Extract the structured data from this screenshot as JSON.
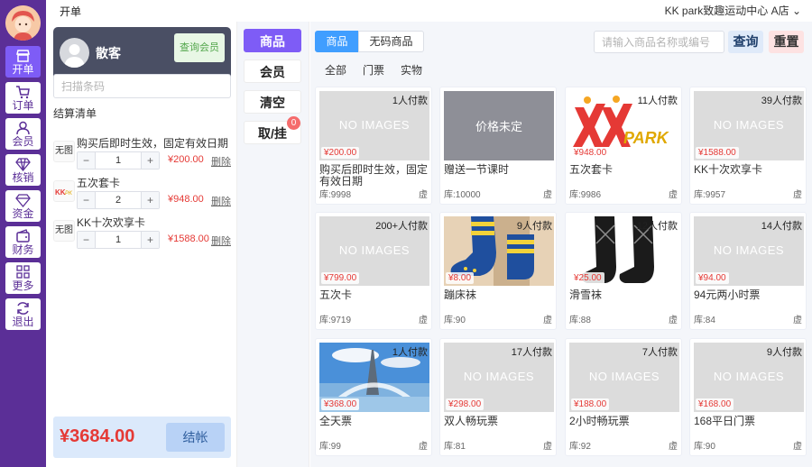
{
  "topbar": {
    "title": "开单",
    "store": "KK park致趣运动中心 A店"
  },
  "nav": [
    {
      "name": "nav-open-order",
      "label": "开单",
      "icon": "store-icon",
      "active": true
    },
    {
      "name": "nav-orders",
      "label": "订单",
      "icon": "cart-icon",
      "active": false
    },
    {
      "name": "nav-members",
      "label": "会员",
      "icon": "user-icon",
      "active": false
    },
    {
      "name": "nav-verify",
      "label": "核销",
      "icon": "diamond-icon",
      "active": false
    },
    {
      "name": "nav-funds",
      "label": "资金",
      "icon": "gem-icon",
      "active": false
    },
    {
      "name": "nav-finance",
      "label": "财务",
      "icon": "wallet-icon",
      "active": false
    },
    {
      "name": "nav-more",
      "label": "更多",
      "icon": "grid-icon",
      "active": false
    },
    {
      "name": "nav-logout",
      "label": "退出",
      "icon": "refresh-icon",
      "active": false
    }
  ],
  "member": {
    "name": "散客",
    "query_label": "查询会员"
  },
  "scan": {
    "placeholder": "扫描条码"
  },
  "cart": {
    "title": "结算清单",
    "delete_label": "删除",
    "items": [
      {
        "thumb": "无图",
        "name": "购买后即时生效，固定有效日期",
        "qty": "1",
        "price": "¥200.00"
      },
      {
        "thumb": "kk-logo",
        "name": "五次套卡",
        "qty": "2",
        "price": "¥948.00"
      },
      {
        "thumb": "无图",
        "name": "KK十次欢享卡",
        "qty": "1",
        "price": "¥1588.00"
      }
    ],
    "total": "¥3684.00",
    "checkout_label": "结帐"
  },
  "actions": {
    "goods": "商品",
    "member": "会员",
    "clear": "清空",
    "pickup": "取/挂",
    "pickup_badge": "0"
  },
  "product_tabs": [
    {
      "label": "商品",
      "active": true
    },
    {
      "label": "无码商品",
      "active": false
    }
  ],
  "search": {
    "placeholder": "请输入商品名称或编号",
    "query_label": "查询",
    "reset_label": "重置"
  },
  "categories": [
    "全部",
    "门票",
    "实物"
  ],
  "no_image_text": "NO IMAGES",
  "products": [
    {
      "image": "none",
      "paid": "1人付款",
      "price": "¥200.00",
      "name": "购买后即时生效，固定有效日期",
      "stock": "库:9998",
      "flag": "虚"
    },
    {
      "image": "tbd",
      "image_text": "价格未定",
      "paid": "",
      "price": "",
      "name": "赠送一节课时",
      "stock": "库:10000",
      "flag": "虚"
    },
    {
      "image": "kk-logo",
      "paid": "11人付款",
      "price": "¥948.00",
      "name": "五次套卡",
      "stock": "库:9986",
      "flag": "虚"
    },
    {
      "image": "none",
      "paid": "39人付款",
      "price": "¥1588.00",
      "name": "KK十次欢享卡",
      "stock": "库:9957",
      "flag": "虚"
    },
    {
      "image": "none",
      "paid": "200+人付款",
      "price": "¥799.00",
      "name": "五次卡",
      "stock": "库:9719",
      "flag": "虚"
    },
    {
      "image": "socks",
      "paid": "9人付款",
      "price": "¥8.00",
      "name": "蹦床袜",
      "stock": "库:90",
      "flag": "虚"
    },
    {
      "image": "ski-socks",
      "paid": "12人付款",
      "price": "¥25.00",
      "name": "滑雪袜",
      "stock": "库:88",
      "flag": "虚"
    },
    {
      "image": "none",
      "paid": "14人付款",
      "price": "¥94.00",
      "name": "94元两小时票",
      "stock": "库:84",
      "flag": "虚"
    },
    {
      "image": "tower",
      "paid": "1人付款",
      "price": "¥368.00",
      "name": "全天票",
      "stock": "库:99",
      "flag": "虚"
    },
    {
      "image": "none",
      "paid": "17人付款",
      "price": "¥298.00",
      "name": "双人畅玩票",
      "stock": "库:81",
      "flag": "虚"
    },
    {
      "image": "none",
      "paid": "7人付款",
      "price": "¥188.00",
      "name": "2小时畅玩票",
      "stock": "库:92",
      "flag": "虚"
    },
    {
      "image": "none",
      "paid": "9人付款",
      "price": "¥168.00",
      "name": "168平日门票",
      "stock": "库:90",
      "flag": "虚"
    }
  ],
  "colors": {
    "nav_bg": "#5b2f97",
    "accent": "#7e5cf6",
    "tab_active": "#409eff",
    "price": "#e53935"
  }
}
